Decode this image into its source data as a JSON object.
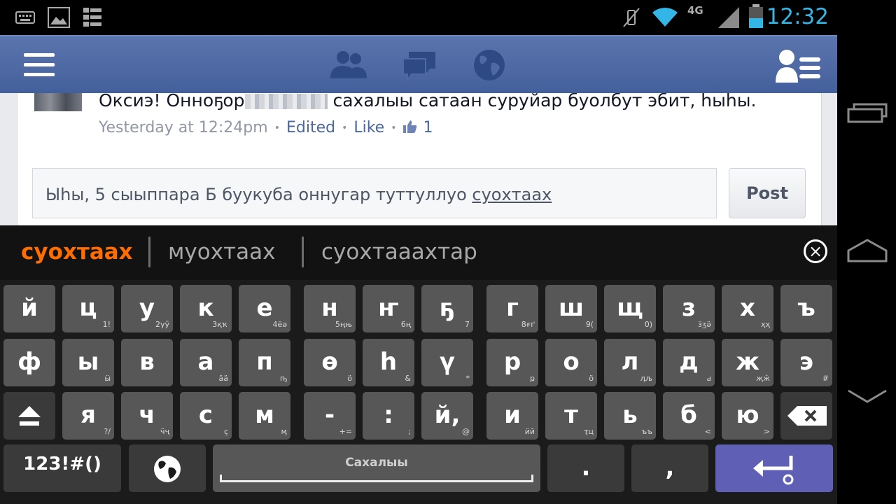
{
  "status_bar": {
    "clock": "12:32",
    "network_label": "4G",
    "icons": [
      "keyboard-icon",
      "image-icon",
      "list-icon",
      "vibrate-off-icon",
      "wifi-icon",
      "signal-icon",
      "battery-icon"
    ],
    "accent_color": "#33b5e5"
  },
  "app_nav": {
    "icons": [
      "menu-icon",
      "friends-icon",
      "messages-icon",
      "globe-icon",
      "profile-list-icon"
    ],
    "color": "#3b5998"
  },
  "comment": {
    "text_before": "Оксиэ! Онноҕор",
    "text_after": " сахалыы сатаан суруйар буолбут эбит, һыһы.",
    "time": "Yesterday at 12:24pm",
    "edited": "Edited",
    "like": "Like",
    "like_count": "1"
  },
  "reply": {
    "text_prefix": "Ыһы, 5 сыыппара Б буукуба оннугар туттуллуо ",
    "text_underlined": "суохтаах",
    "post_label": "Post"
  },
  "suggestions": [
    {
      "label": "суохтаах",
      "color": "#ff6d00"
    },
    {
      "label": "муохтаах",
      "color": "#a8a8a8"
    },
    {
      "label": "суохтааахтар",
      "color": "#a8a8a8"
    }
  ],
  "keys_row1": [
    {
      "m": "й",
      "h": ""
    },
    {
      "m": "ц",
      "h": "1!"
    },
    {
      "m": "у",
      "h": "2үӱ"
    },
    {
      "m": "к",
      "h": "3қҡ"
    },
    {
      "m": "е",
      "h": "4ёә"
    },
    {
      "m": "н",
      "h": "5ңњ"
    },
    {
      "m": "ҥ",
      "h": "6ң"
    },
    {
      "m": "ҕ",
      "h": "7"
    },
    {
      "m": "г",
      "h": "8ғґ"
    },
    {
      "m": "ш",
      "h": "9("
    },
    {
      "m": "щ",
      "h": "0)"
    },
    {
      "m": "з",
      "h": "ӟӡӛ"
    },
    {
      "m": "х",
      "h": "ҳҳ"
    },
    {
      "m": "ъ",
      "h": ""
    }
  ],
  "keys_row2": [
    {
      "m": "ф",
      "h": ""
    },
    {
      "m": "ы",
      "h": "ӹ"
    },
    {
      "m": "в",
      "h": ""
    },
    {
      "m": "а",
      "h": "ӑӓ"
    },
    {
      "m": "п",
      "h": "ҧ"
    },
    {
      "m": "ө",
      "h": "ӧ"
    },
    {
      "m": "һ",
      "h": "&"
    },
    {
      "m": "ү",
      "h": "*"
    },
    {
      "m": "р",
      "h": "ҏ"
    },
    {
      "m": "о",
      "h": "ӧ"
    },
    {
      "m": "л",
      "h": "ӆљ"
    },
    {
      "m": "д",
      "h": "ԁ"
    },
    {
      "m": "ж",
      "h": "җӂ"
    },
    {
      "m": "э",
      "h": "#"
    }
  ],
  "keys_row3": [
    {
      "m": "я",
      "h": "?/"
    },
    {
      "m": "ч",
      "h": "ӵҷ"
    },
    {
      "m": "с",
      "h": "ҫ"
    },
    {
      "m": "м",
      "h": "ӎ"
    },
    {
      "m": "-",
      "h": "+="
    },
    {
      "m": ":",
      "h": ";"
    },
    {
      "m": "й,",
      "h": "@"
    },
    {
      "m": "и",
      "h": "ӥӣ"
    },
    {
      "m": "т",
      "h": "ҭц"
    },
    {
      "m": "ь",
      "h": "ъъ"
    },
    {
      "m": "б",
      "h": "<"
    },
    {
      "m": "ю",
      "h": ">"
    }
  ],
  "bottom_row": {
    "symbols": "123!#()",
    "space": "Сахалыы",
    "period": ".",
    "comma": ",",
    "key_color": "#575757",
    "enter_color": "#5f60b5"
  }
}
